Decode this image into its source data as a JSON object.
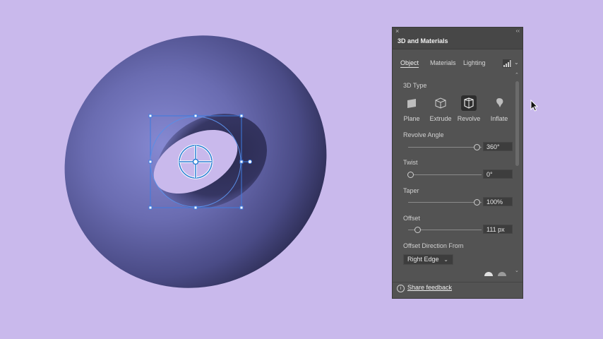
{
  "panel": {
    "close_glyph": "×",
    "collapse_glyph": "‹‹",
    "title": "3D and Materials",
    "tabs": [
      {
        "label": "Object",
        "active": true
      },
      {
        "label": "Materials",
        "active": false
      },
      {
        "label": "Lighting",
        "active": false
      }
    ],
    "section_3d_type": "3D Type",
    "types": [
      {
        "label": "Plane",
        "icon": "plane-icon"
      },
      {
        "label": "Extrude",
        "icon": "extrude-icon"
      },
      {
        "label": "Revolve",
        "icon": "revolve-icon",
        "active": true
      },
      {
        "label": "Inflate",
        "icon": "inflate-icon"
      }
    ],
    "controls": [
      {
        "label": "Revolve Angle",
        "value": "360°",
        "fraction": 1.0
      },
      {
        "label": "Twist",
        "value": "0°",
        "fraction": 0.0
      },
      {
        "label": "Taper",
        "value": "100%",
        "fraction": 1.0
      },
      {
        "label": "Offset",
        "value": "111 px",
        "fraction": 0.11
      }
    ],
    "offset_direction_label": "Offset Direction From",
    "offset_direction_value": "Right Edge",
    "footer_info_glyph": "i",
    "share_feedback": "Share feedback"
  },
  "colors": {
    "background": "#c9b9ec",
    "torus_base": "#6a6cb0",
    "panel_bg": "#535353",
    "selection": "#2a7fd4"
  }
}
